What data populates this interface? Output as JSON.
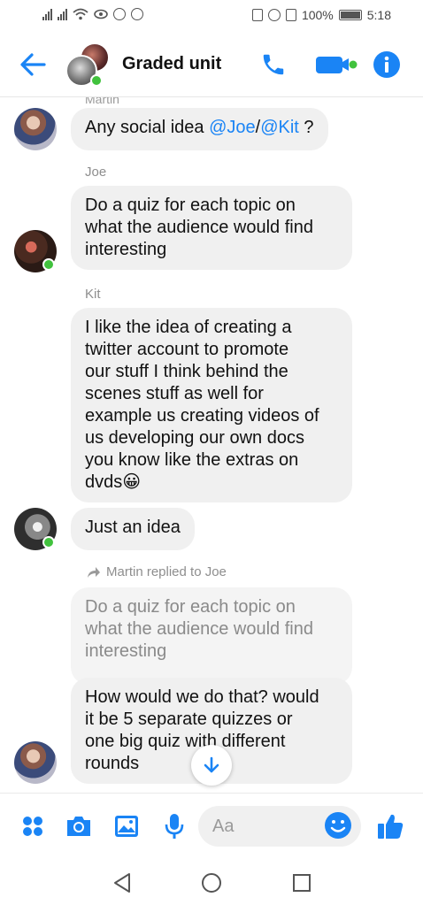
{
  "status_bar": {
    "battery_percent": "100%",
    "time": "5:18"
  },
  "header": {
    "title": "Graded unit",
    "icons": [
      "back-arrow-icon",
      "phone-icon",
      "video-camera-icon",
      "info-icon"
    ],
    "accent_color": "#1a84f5",
    "online_color": "#41c23d"
  },
  "messages": {
    "cut_off_name": "Martin",
    "m1": {
      "pre": "Any social idea ",
      "mention1": "@Joe",
      "sep": "/",
      "mention2": "@Kit",
      "post": " ?"
    },
    "joe_name": "Joe",
    "m2_lines": [
      "Do a quiz for each topic on",
      "what the audience would find",
      "interesting"
    ],
    "kit_name": "Kit",
    "m3_lines": [
      "I like the idea of creating a",
      "twitter account to promote",
      "our stuff I think behind the",
      "scenes stuff as well for",
      "example us creating videos of",
      "us developing our own docs",
      "you know like the extras on",
      "dvds"
    ],
    "m3_emoji": "😀",
    "m4": "Just an idea",
    "reply_note": "Martin replied to Joe",
    "quoted_lines": [
      "Do a quiz for each topic on",
      "what the audience would find",
      "interesting"
    ],
    "m5_lines": [
      "How would we do that? would",
      "it be 5 separate quizzes or",
      "one big quiz with different",
      "rounds"
    ]
  },
  "composer": {
    "placeholder": "Aa",
    "icons": [
      "apps-grid-icon",
      "camera-icon",
      "gallery-icon",
      "microphone-icon",
      "emoji-icon",
      "thumbs-up-icon"
    ]
  },
  "navbar": {
    "icons": [
      "nav-back-icon",
      "nav-home-icon",
      "nav-recents-icon"
    ]
  }
}
